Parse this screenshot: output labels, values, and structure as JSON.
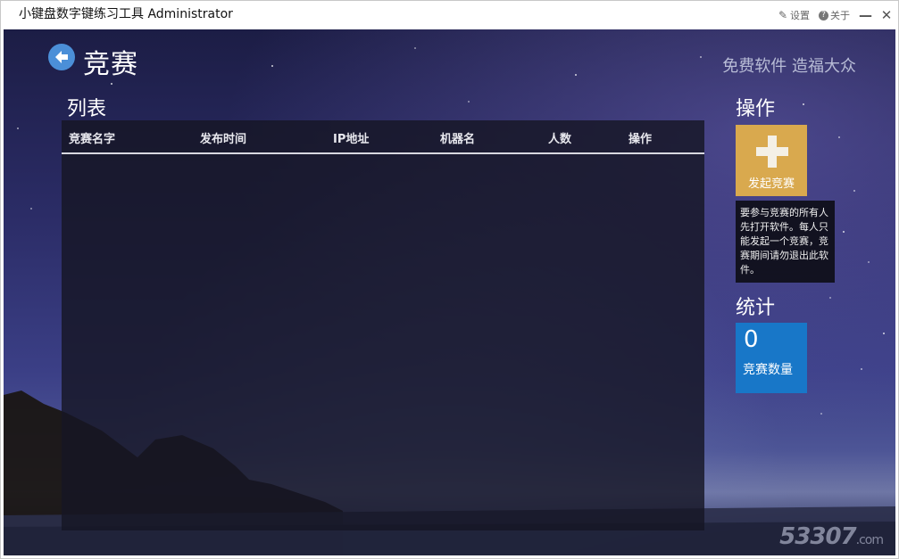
{
  "app": {
    "title": "小键盘数字键练习工具 Administrator",
    "settings_label": "设置",
    "about_label": "关于",
    "minimize_label": "—",
    "close_label": "✕"
  },
  "header": {
    "title": "竞赛",
    "slogan": "免费软件  造福大众"
  },
  "list": {
    "section_title": "列表",
    "columns": [
      "竞赛名字",
      "发布时间",
      "IP地址",
      "机器名",
      "人数",
      "操作"
    ],
    "rows": []
  },
  "operations": {
    "section_title": "操作",
    "start_label": "发起竞赛",
    "tooltip": "要参与竞赛的所有人先打开软件。每人只能发起一个竞赛，竞赛期间请勿退出此软件。",
    "tile_color": "#d9a94e"
  },
  "stats": {
    "section_title": "统计",
    "count": "0",
    "count_label": "竞赛数量",
    "tile_color": "#1877c8"
  },
  "watermark": {
    "text": "53307",
    "domain": ".com"
  }
}
